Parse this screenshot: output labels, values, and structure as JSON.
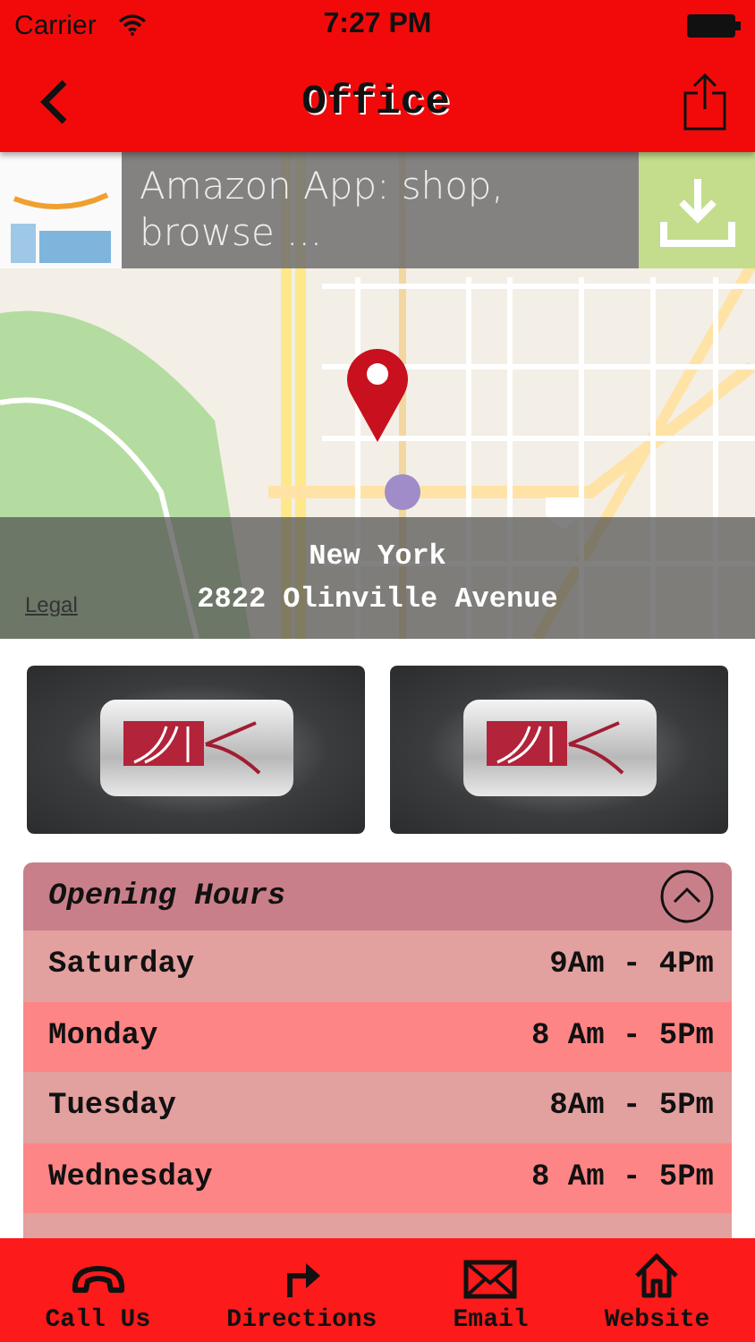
{
  "status_bar": {
    "carrier": "Carrier",
    "time": "7:27 PM"
  },
  "nav": {
    "title": "Office"
  },
  "map": {
    "ad": {
      "title": "Amazon App: shop, browse ..."
    },
    "legal": "Legal",
    "city": "New York",
    "address": "2822 Olinville Avenue"
  },
  "logo_cards": [
    {
      "kind": "logo"
    },
    {
      "kind": "logo"
    }
  ],
  "hours": {
    "title": "Opening Hours",
    "expanded": true,
    "rows": [
      {
        "day": "Saturday",
        "time": "9Am - 4Pm"
      },
      {
        "day": "Monday",
        "time": "8 Am - 5Pm"
      },
      {
        "day": "Tuesday",
        "time": "8Am - 5Pm"
      },
      {
        "day": "Wednesday",
        "time": "8 Am - 5Pm"
      }
    ]
  },
  "tabs": [
    {
      "label": "Call Us",
      "kind": "call"
    },
    {
      "label": "Directions",
      "kind": "directions"
    },
    {
      "label": "Email",
      "kind": "email"
    },
    {
      "label": "Website",
      "kind": "website"
    }
  ]
}
